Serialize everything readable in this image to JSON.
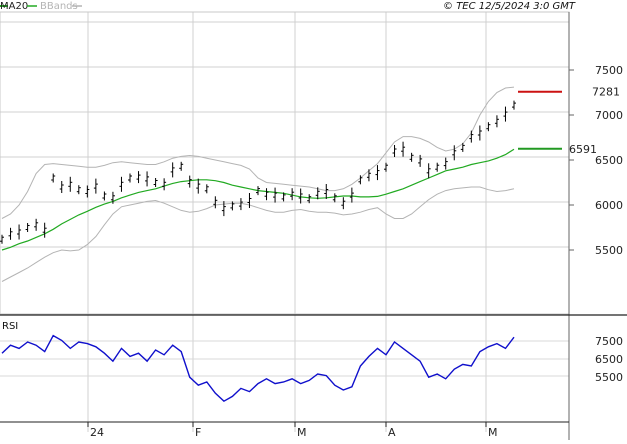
{
  "header": {
    "legend": [
      {
        "label": "MA20",
        "color": "#22aa22"
      },
      {
        "label": "BBands",
        "color": "#b4b4b4"
      }
    ],
    "copyright": "© TEC 12/5/2024 3:0 GMT"
  },
  "chart_data": [
    {
      "type": "line",
      "title": "",
      "y_axis_labels": [
        "7500",
        "7000",
        "6500",
        "6000",
        "5500"
      ],
      "x_axis_labels": [
        "24",
        "F",
        "M",
        "A",
        "M"
      ],
      "ylim": [
        5100,
        7900
      ],
      "grid": true,
      "legend_position": "top-left",
      "series": [
        {
          "name": "MA20",
          "color": "#22aa22",
          "values": [
            5500,
            5530,
            5570,
            5600,
            5640,
            5680,
            5730,
            5790,
            5840,
            5890,
            5930,
            5975,
            6010,
            6040,
            6080,
            6110,
            6140,
            6160,
            6180,
            6210,
            6240,
            6260,
            6270,
            6280,
            6280,
            6270,
            6250,
            6220,
            6200,
            6180,
            6160,
            6150,
            6140,
            6130,
            6110,
            6090,
            6080,
            6075,
            6080,
            6090,
            6100,
            6100,
            6090,
            6090,
            6095,
            6120,
            6150,
            6180,
            6220,
            6260,
            6300,
            6340,
            6380,
            6400,
            6420,
            6450,
            6470,
            6490,
            6520,
            6560,
            6620
          ]
        },
        {
          "name": "BBands upper",
          "color": "#b4b4b4",
          "values": [
            5850,
            5900,
            6000,
            6150,
            6350,
            6450,
            6460,
            6450,
            6440,
            6430,
            6420,
            6420,
            6440,
            6470,
            6480,
            6470,
            6460,
            6450,
            6450,
            6480,
            6520,
            6540,
            6550,
            6540,
            6520,
            6500,
            6480,
            6460,
            6440,
            6400,
            6300,
            6250,
            6240,
            6230,
            6220,
            6210,
            6200,
            6180,
            6160,
            6160,
            6180,
            6230,
            6300,
            6380,
            6460,
            6580,
            6700,
            6760,
            6760,
            6740,
            6700,
            6640,
            6600,
            6620,
            6680,
            6800,
            7000,
            7150,
            7250,
            7300,
            7310
          ]
        },
        {
          "name": "BBands lower",
          "color": "#b4b4b4",
          "values": [
            5150,
            5200,
            5250,
            5300,
            5360,
            5420,
            5470,
            5500,
            5490,
            5500,
            5560,
            5650,
            5780,
            5900,
            5980,
            6000,
            6020,
            6040,
            6050,
            6020,
            5980,
            5940,
            5920,
            5930,
            5960,
            6000,
            6010,
            6020,
            6020,
            6000,
            5970,
            5940,
            5920,
            5920,
            5940,
            5950,
            5930,
            5920,
            5920,
            5910,
            5890,
            5900,
            5920,
            5950,
            5970,
            5900,
            5850,
            5850,
            5900,
            5980,
            6060,
            6120,
            6160,
            6180,
            6190,
            6200,
            6200,
            6170,
            6150,
            6160,
            6180
          ]
        },
        {
          "name": "Price",
          "color": "#000000",
          "values": [
            5620,
            5680,
            5700,
            5750,
            5780,
            5720,
            6300,
            6200,
            6230,
            6170,
            6150,
            6210,
            6100,
            6080,
            6230,
            6300,
            6310,
            6290,
            6250,
            6230,
            6390,
            6430,
            6260,
            6210,
            6180,
            6030,
            5960,
            5990,
            6010,
            6050,
            6160,
            6120,
            6110,
            6090,
            6120,
            6100,
            6070,
            6130,
            6150,
            6080,
            6020,
            6110,
            6280,
            6330,
            6360,
            6420,
            6600,
            6620,
            6530,
            6490,
            6380,
            6420,
            6460,
            6580,
            6640,
            6760,
            6800,
            6870,
            6930,
            7010,
            7110
          ]
        }
      ],
      "annotations": [
        {
          "label": "7281",
          "value": 7281,
          "color": "#cc1111"
        },
        {
          "label": "6591",
          "value": 6591,
          "color": "#229922"
        }
      ]
    },
    {
      "type": "line",
      "title": "RSI",
      "y_axis_labels": [
        "7500",
        "6500",
        "5500"
      ],
      "series": [
        {
          "name": "RSI",
          "color": "#1010cc",
          "values": [
            63,
            68,
            66,
            70,
            68,
            64,
            74,
            71,
            66,
            70,
            69,
            67,
            63,
            58,
            66,
            61,
            63,
            58,
            65,
            62,
            68,
            64,
            48,
            43,
            45,
            38,
            33,
            36,
            41,
            39,
            44,
            47,
            44,
            45,
            47,
            44,
            46,
            50,
            49,
            43,
            40,
            42,
            55,
            61,
            66,
            62,
            70,
            66,
            62,
            58,
            48,
            50,
            47,
            53,
            56,
            55,
            64,
            67,
            69,
            66,
            73
          ]
        }
      ]
    }
  ]
}
